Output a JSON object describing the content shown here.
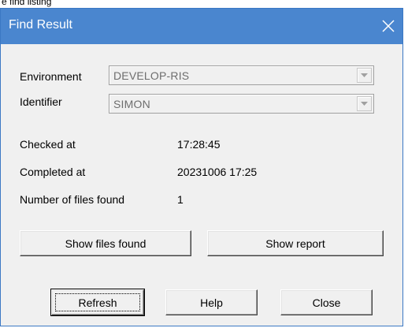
{
  "background_snippet": "e find listing",
  "window": {
    "title": "Find Result",
    "close_icon": "close-icon",
    "titlebar_color": "#4a86cf"
  },
  "form": {
    "environment": {
      "label": "Environment",
      "value": "DEVELOP-RIS"
    },
    "identifier": {
      "label": "Identifier",
      "value": "SIMON"
    }
  },
  "info": {
    "checked_at": {
      "label": "Checked at",
      "value": "17:28:45"
    },
    "completed_at": {
      "label": "Completed at",
      "value": "20231006 17:25"
    },
    "files_found": {
      "label": "Number of files found",
      "value": "1"
    }
  },
  "actions": {
    "show_files_found": "Show files found",
    "show_report": "Show report"
  },
  "footer": {
    "refresh": "Refresh",
    "help": "Help",
    "close": "Close"
  }
}
